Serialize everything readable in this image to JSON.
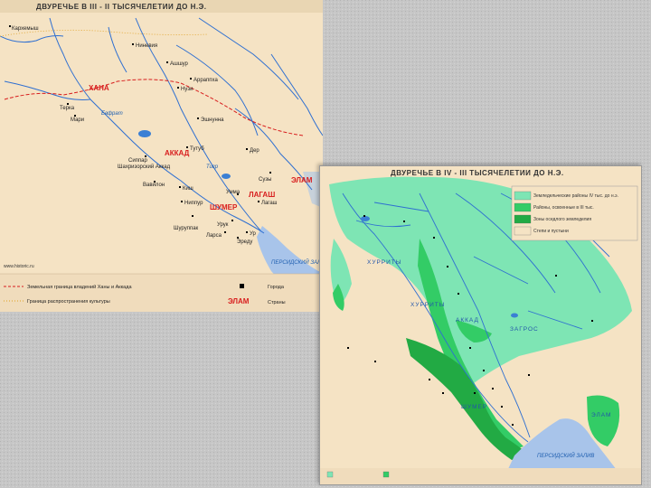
{
  "map1": {
    "title": "ДВУРЕЧЬЕ В III - II ТЫСЯЧЕЛЕТИИ ДО Н.Э.",
    "regions": [
      "ХАНА",
      "АККАД",
      "ЛАГАШ",
      "ШУМЕР",
      "ЭЛАМ"
    ],
    "cities": [
      "Кархемыш",
      "Ниневия",
      "Ашшур",
      "Арраппха",
      "Нузи",
      "Терка",
      "Мари",
      "Эшнунна",
      "Сиппар",
      "Вавилон",
      "Киш",
      "Ниппур",
      "Урук",
      "Ур",
      "Эреду",
      "Лагаш",
      "Умма",
      "Ларса",
      "Шуруппак",
      "Дер",
      "Сузы",
      "Шахризорский Аккад",
      "Тутуб"
    ],
    "rivers": [
      "Евфрат",
      "Тигр"
    ],
    "sea": "ПЕРСИДСКИЙ ЗАЛИВ",
    "legend": [
      {
        "symbol": "dash",
        "label": "Земельная граница владений Ханы и Аккада"
      },
      {
        "symbol": "dotted",
        "label": "Граница распространения культуры"
      },
      {
        "symbol": "square",
        "label": "Города"
      },
      {
        "symbol": "region-label",
        "sample": "ЭЛАМ",
        "label": "Страны"
      }
    ],
    "credit": "www.historic.ru"
  },
  "map2": {
    "title": "ДВУРЕЧЬЕ В IV - III ТЫСЯЧЕЛЕТИИ ДО Н.Э.",
    "regions": [
      "ХУРРИТЫ",
      "ХУРРИТЫ",
      "АККАД",
      "ШУМЕР",
      "ЭЛАМ",
      "ЗАГРОС"
    ],
    "sea": "ПЕРСИДСКИЙ ЗАЛИВ",
    "colors": {
      "light_green": "#7ee5b4",
      "green": "#33cc66",
      "dark_green": "#22aa44",
      "land": "#f5e3c4",
      "water": "#3b7fd4"
    },
    "legend": [
      {
        "color": "#7ee5b4",
        "label": "Земледельческие районы IV тыс. до н.э."
      },
      {
        "color": "#33cc66",
        "label": "Районы, освоенные в III тыс."
      },
      {
        "color": "#22aa44",
        "label": "Зоны оседлого земледелия"
      },
      {
        "color": "#f5e3c4",
        "label": "Степи и пустыни"
      }
    ]
  },
  "colors": {
    "red": "#d81e1e",
    "river": "#2e6fd1",
    "land": "#f5e3c4"
  }
}
